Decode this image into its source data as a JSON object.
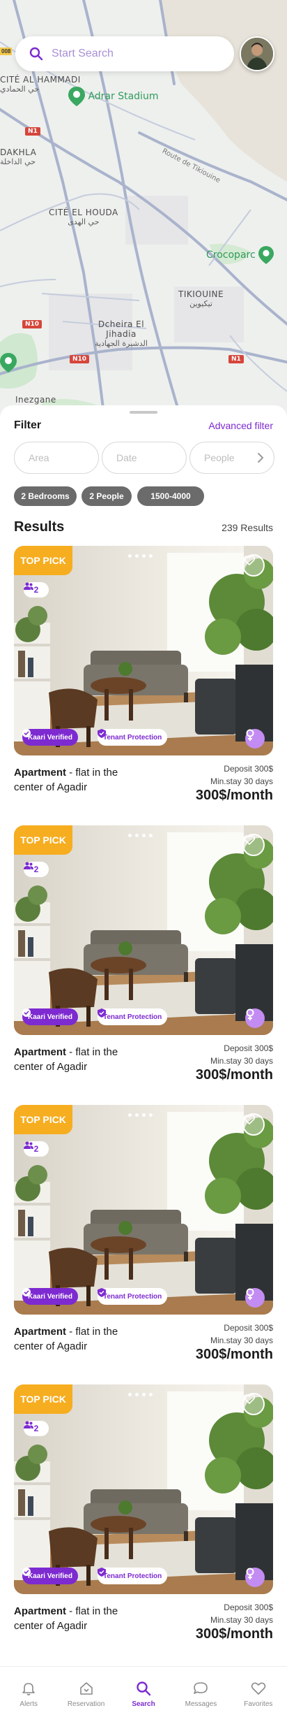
{
  "search": {
    "placeholder": "Start Search"
  },
  "map": {
    "labels": [
      {
        "name": "CITÉ AL HAMMADI",
        "arabic": "حي الحمادي"
      },
      {
        "name": "DAKHLA",
        "arabic": "حي الداخلة"
      },
      {
        "name": "CITÉ EL HOUDA",
        "arabic": "حي الهدى"
      },
      {
        "name": "Dcheira El Jihadia",
        "arabic": "الدشيرة الجهادية"
      },
      {
        "name": "TIKIOUINE",
        "arabic": "تيكيوين"
      },
      {
        "name": "Inezgane"
      }
    ],
    "pois": [
      "Adrar Stadium",
      "Crocoparc"
    ],
    "roads": [
      "N1",
      "N10",
      "N10",
      "N1",
      "Route de Tikiouine"
    ],
    "left_tag": "008"
  },
  "filter": {
    "title": "Filter",
    "advanced_label": "Advanced filter",
    "area_placeholder": "Area",
    "date_placeholder": "Date",
    "people_placeholder": "People",
    "chips": [
      "2 Bedrooms",
      "2 People",
      "1500-4000"
    ]
  },
  "results": {
    "title": "Results",
    "count": "239 Results"
  },
  "listings": [
    {
      "top_pick": "TOP PICK",
      "people": "2",
      "verified": "Kaari Verified",
      "tenant": "Tenant Protection",
      "type": "Apartment",
      "description": " - flat in the center of Agadir",
      "deposit": "Deposit 300$",
      "min_stay": "Min.stay 30 days",
      "price": "300$/month"
    },
    {
      "top_pick": "TOP PICK",
      "people": "2",
      "verified": "Kaari Verified",
      "tenant": "Tenant Protection",
      "type": "Apartment",
      "description": " - flat in the center of Agadir",
      "deposit": "Deposit 300$",
      "min_stay": "Min.stay 30 days",
      "price": "300$/month"
    },
    {
      "top_pick": "TOP PICK",
      "people": "2",
      "verified": "Kaari Verified",
      "tenant": "Tenant Protection",
      "type": "Apartment",
      "description": " - flat in the center of Agadir",
      "deposit": "Deposit 300$",
      "min_stay": "Min.stay 30 days",
      "price": "300$/month"
    },
    {
      "top_pick": "TOP PICK",
      "people": "2",
      "verified": "Kaari Verified",
      "tenant": "Tenant Protection",
      "type": "Apartment",
      "description": " - flat in the center of Agadir",
      "deposit": "Deposit 300$",
      "min_stay": "Min.stay 30 days",
      "price": "300$/month"
    }
  ],
  "tabs": [
    {
      "label": "Alerts",
      "icon": "bell-icon"
    },
    {
      "label": "Reservation",
      "icon": "house-icon"
    },
    {
      "label": "Search",
      "icon": "search-icon",
      "active": true
    },
    {
      "label": "Messages",
      "icon": "chat-icon"
    },
    {
      "label": "Favorites",
      "icon": "heart-icon"
    }
  ],
  "colors": {
    "accent": "#7d2ad1",
    "top_pick": "#f6ad1f",
    "chip": "#6b6b6b",
    "gender": "#c38cf2"
  }
}
